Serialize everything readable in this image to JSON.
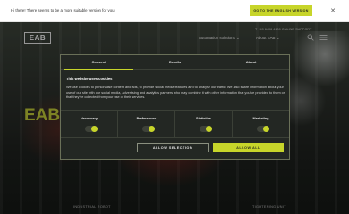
{
  "notice": {
    "text": "Hi there! There seems to be a more suitable version for you.",
    "button_label": "GO TO THE ENGLISH VERSION",
    "close_glyph": "✕"
  },
  "site": {
    "logo": "EAB",
    "contact": "T +49 6406 4100   ONLINE SUPPORT",
    "nav": {
      "solutions": "Automation solutions ⌄",
      "about": "About EAB ⌄"
    },
    "hero_text": "EAB",
    "bottom_links": [
      "INDUSTRIAL ROBOT",
      "TIGHTENING UNIT"
    ]
  },
  "cookie_dialog": {
    "tabs": [
      {
        "label": "Consent",
        "active": true
      },
      {
        "label": "Details",
        "active": false
      },
      {
        "label": "About",
        "active": false
      }
    ],
    "title": "This website uses cookies",
    "body": "We use cookies to personalise content and ads, to provide social media features and to analyse our traffic. We also share information about your use of our site with our social media, advertising and analytics partners who may combine it with other information that you've provided to them or that they've collected from your use of their services.",
    "categories": [
      {
        "label": "Necessary",
        "state": "on"
      },
      {
        "label": "Preferences",
        "state": "on"
      },
      {
        "label": "Statistics",
        "state": "on"
      },
      {
        "label": "Marketing",
        "state": "on"
      }
    ],
    "allow_selection_label": "ALLOW SELECTION",
    "allow_all_label": "ALLOW ALL"
  },
  "colors": {
    "accent": "#c7d52a",
    "dialog_bg": "#232723"
  },
  "icons": [
    "close-icon",
    "search-icon",
    "menu-icon"
  ]
}
